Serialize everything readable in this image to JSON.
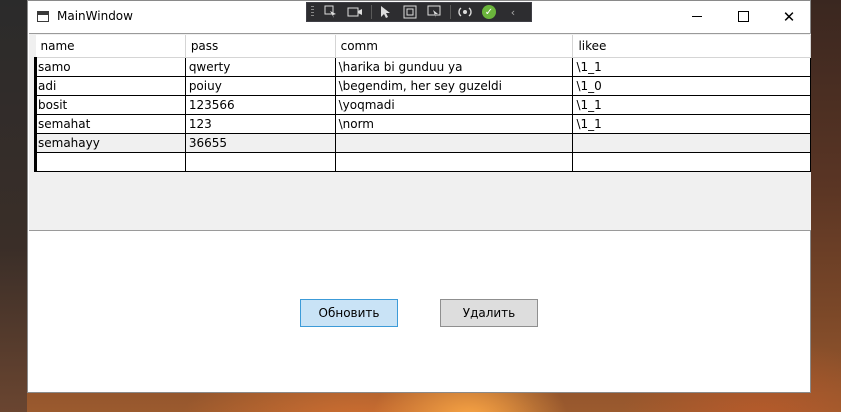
{
  "window": {
    "title": "MainWindow",
    "controls": {
      "minimize": "—",
      "maximize": "☐",
      "close": "✕"
    }
  },
  "debug_toolbar": {
    "icons": [
      "select-element-icon",
      "record-icon",
      "pointer-icon",
      "frame-icon",
      "track-focus-icon",
      "hot-reload-icon",
      "ok-check-icon",
      "collapse-chevron-icon"
    ]
  },
  "grid": {
    "columns": [
      "name",
      "pass",
      "comm",
      "likee"
    ],
    "rows": [
      [
        "samo",
        "qwerty",
        "\\harika bi gunduu ya",
        "\\1_1"
      ],
      [
        "adi",
        "poiuy",
        "\\begendim, her sey  guzeldi",
        "\\1_0"
      ],
      [
        "bosit",
        "123566",
        "\\yoqmadi",
        "\\1_1"
      ],
      [
        "semahat",
        "123",
        "\\norm",
        "\\1_1"
      ],
      [
        "semahayy",
        "36655",
        "",
        ""
      ],
      [
        "",
        "",
        "",
        ""
      ]
    ]
  },
  "buttons": {
    "refresh": "Обновить",
    "delete": "Удалить"
  },
  "colors": {
    "refresh_bg": "#c9e3f6",
    "refresh_border": "#3c9bd8",
    "delete_bg": "#dddddd",
    "grid_background": "#f0f0f0"
  }
}
